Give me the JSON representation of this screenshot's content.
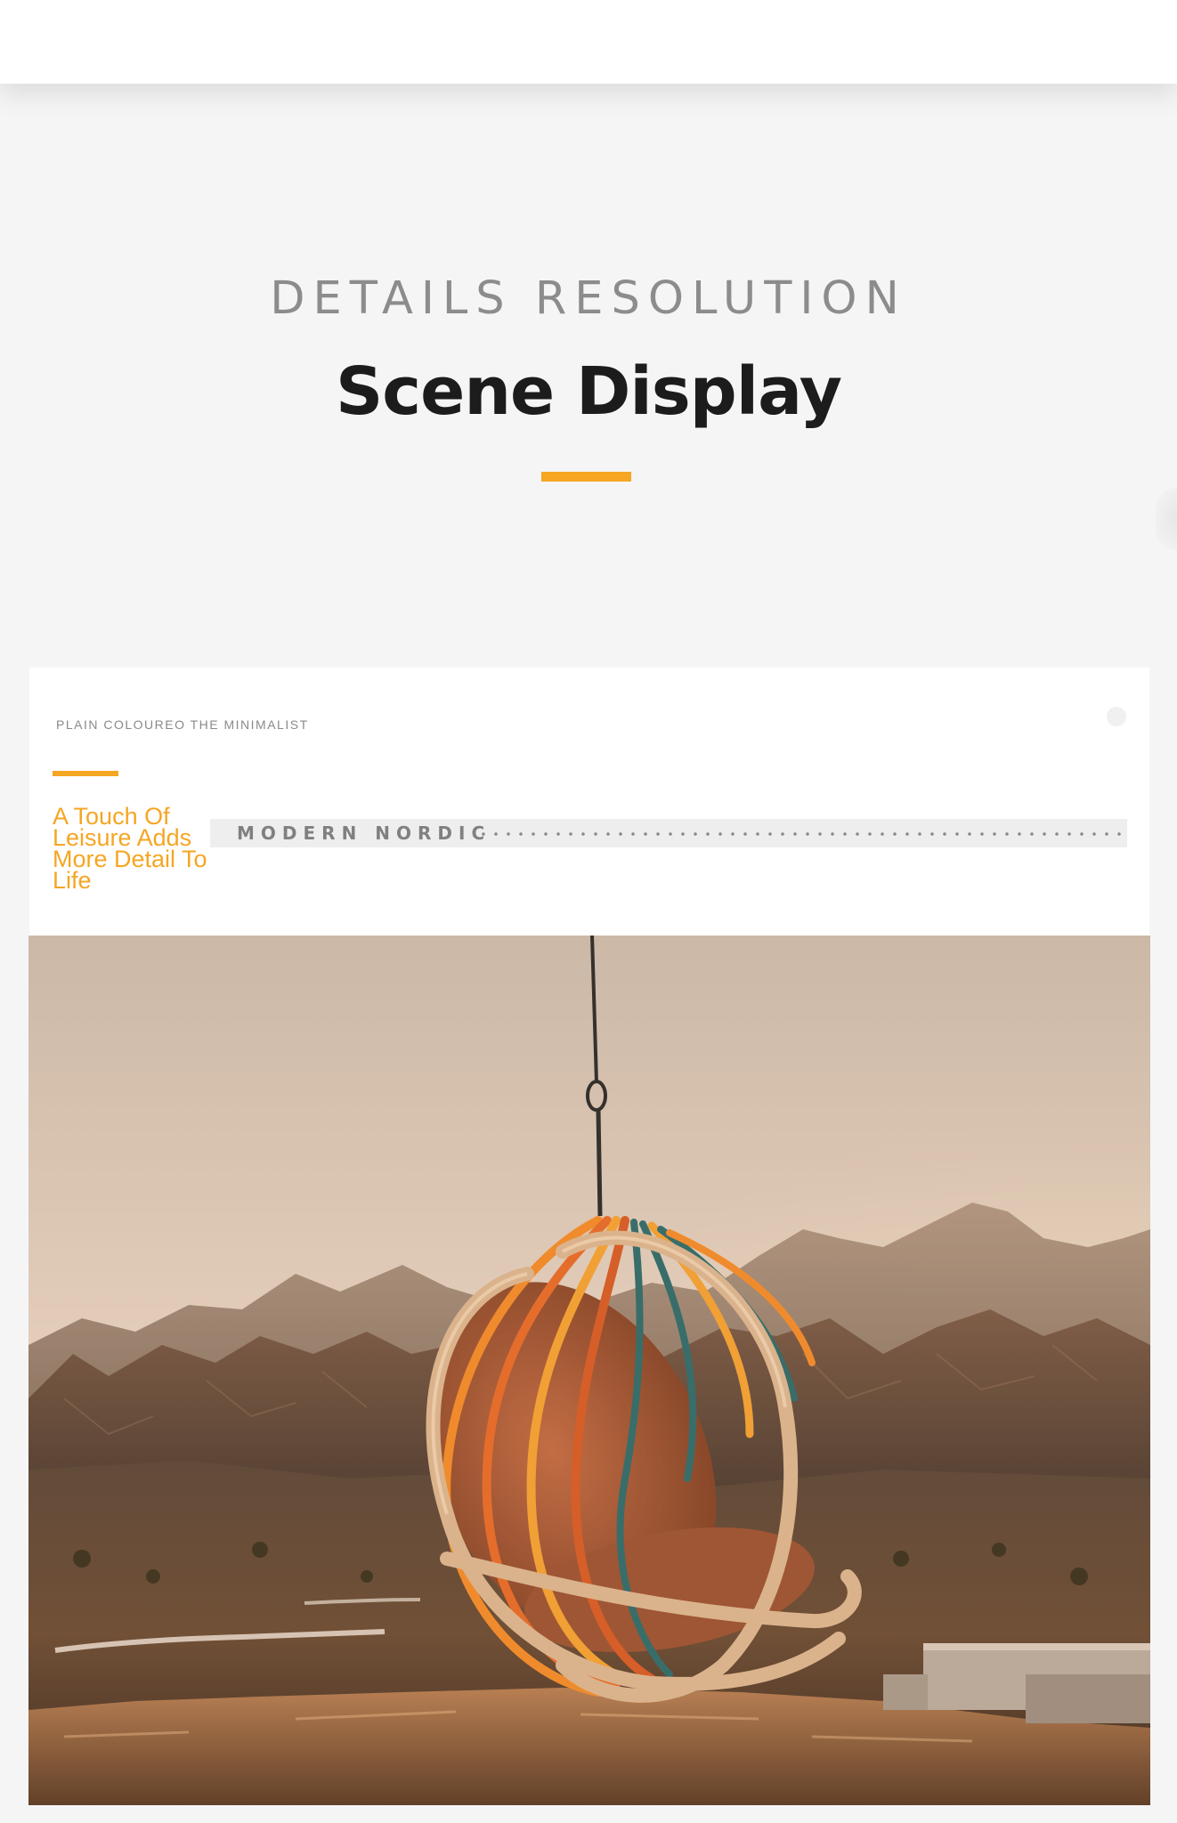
{
  "header": {
    "kicker": "DETAILS RESOLUTION",
    "title": "Scene Display"
  },
  "card": {
    "kicker": "PLAIN COLOUREO THE MINIMALIST",
    "tagline": "A Touch Of Leisure Adds More Detail To Life",
    "strip_label": "MODERN NORDIC"
  },
  "scene": {
    "subject": "hanging egg chair",
    "setting": "mountain landscape at dusk"
  },
  "colors": {
    "accent": "#f5a623",
    "title": "#1c1c1c",
    "kicker": "#8c8c8c",
    "background": "#f5f5f6"
  }
}
